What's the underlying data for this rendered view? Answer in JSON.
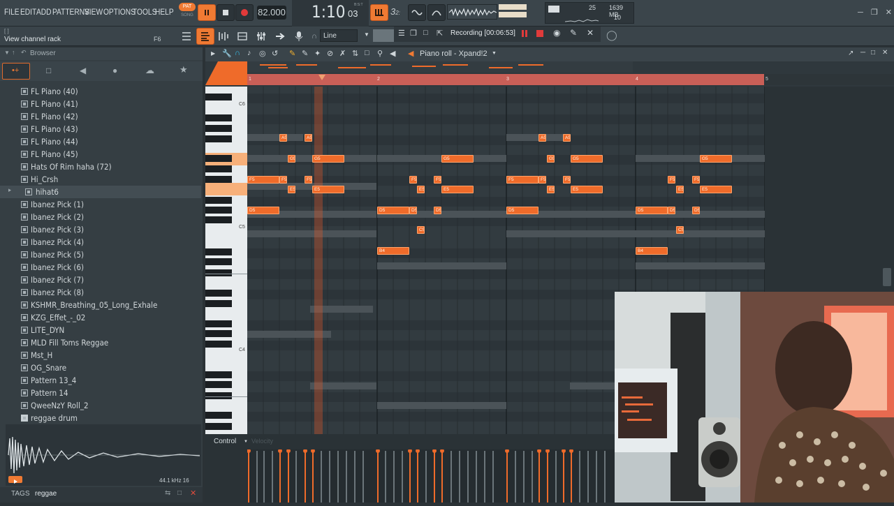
{
  "menu": [
    "FILE",
    "EDIT",
    "ADD",
    "PATTERNS",
    "VIEW",
    "OPTIONS",
    "TOOLS",
    "HELP"
  ],
  "transport": {
    "pat_label": "PAT",
    "song_label": "SONG",
    "tempo": "82.000",
    "time": "1:10",
    "time_sub": "03",
    "time_unit": "B:S:T",
    "pattern_num": "3",
    "cpu": "25",
    "memory": "1639 MB",
    "polyphony": "10"
  },
  "hint": {
    "bracket": "[ ]",
    "text": "View channel rack",
    "shortcut": "F6"
  },
  "snap": "Line",
  "recording": "Recording [00:06:53]",
  "browser": {
    "title": "Browser",
    "items": [
      {
        "label": "FL Piano (40)"
      },
      {
        "label": "FL Piano (41)"
      },
      {
        "label": "FL Piano (42)"
      },
      {
        "label": "FL Piano (43)"
      },
      {
        "label": "FL Piano (44)"
      },
      {
        "label": "FL Piano (45)"
      },
      {
        "label": "Hats Of Rim haha (72)"
      },
      {
        "label": "Hi_Crsh"
      },
      {
        "label": "hihat6"
      },
      {
        "label": "Ibanez Pick (1)"
      },
      {
        "label": "Ibanez Pick (2)"
      },
      {
        "label": "Ibanez Pick (3)"
      },
      {
        "label": "Ibanez Pick (4)"
      },
      {
        "label": "Ibanez Pick (5)"
      },
      {
        "label": "Ibanez Pick (6)"
      },
      {
        "label": "Ibanez Pick (7)"
      },
      {
        "label": "Ibanez Pick (8)"
      },
      {
        "label": "KSHMR_Breathing_05_Long_Exhale"
      },
      {
        "label": "KZG_Effet_-_02"
      },
      {
        "label": "LITE_DYN"
      },
      {
        "label": "MLD Fill Toms Reggae"
      },
      {
        "label": "Mst_H"
      },
      {
        "label": "OG_Snare"
      },
      {
        "label": "Pattern 13_4"
      },
      {
        "label": "Pattern 14"
      },
      {
        "label": "QweeNzY Roll_2"
      },
      {
        "label": "reggae drum"
      }
    ],
    "sample_info": "44.1 kHz 16",
    "tags_label": "TAGS",
    "tags_value": "reggae"
  },
  "piano_roll": {
    "title": "Piano roll - Xpand!2",
    "bars": [
      "1",
      "2",
      "3",
      "4",
      "5"
    ],
    "octave_labels": [
      "C6",
      "C5",
      "C4"
    ],
    "control_label": "Control",
    "control_param": "Velocity"
  },
  "colors": {
    "accent": "#ef6b2a",
    "bg": "#2f383d"
  }
}
